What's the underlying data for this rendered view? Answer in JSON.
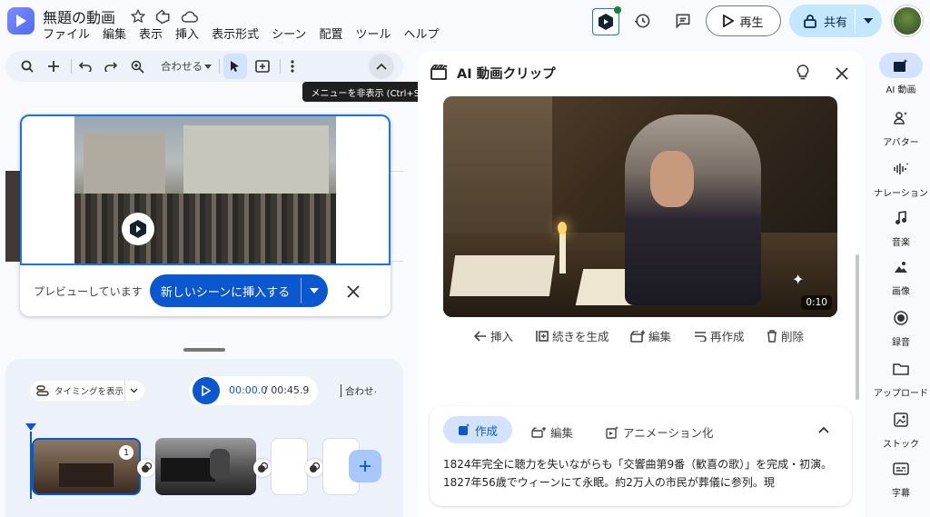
{
  "header": {
    "title": "無題の動画",
    "menus": [
      "ファイル",
      "編集",
      "表示",
      "挿入",
      "表示形式",
      "シーン",
      "配置",
      "ツール",
      "ヘルプ"
    ],
    "play_label": "再生",
    "share_label": "共有"
  },
  "toolbar": {
    "fit_label": "合わせる",
    "tooltip": "メニューを非表示 (Ctrl+Shift+F)"
  },
  "preview": {
    "status_text": "プレビューしています",
    "insert_label": "新しいシーンに挿入する"
  },
  "timeline": {
    "timing_label": "タイミングを表示",
    "current_time": "00:00.0",
    "total_time": "/ 00:45.9",
    "fit_label": "合わせる",
    "scene_badge": "1"
  },
  "panel": {
    "title": "AI 動画クリップ",
    "duration": "0:10",
    "actions": [
      "挿入",
      "続きを生成",
      "編集",
      "再作成",
      "削除"
    ],
    "tabs": [
      "作成",
      "編集",
      "アニメーション化"
    ],
    "description": "1824年完全に聴力を失いながらも「交響曲第9番（歓喜の歌）」を完成・初演。1827年56歳でウィーンにて永眠。約2万人の市民が葬儀に参列。現"
  },
  "rail": [
    "AI 動画",
    "アバター",
    "ナレーション",
    "音楽",
    "画像",
    "録音",
    "アップロード",
    "ストック",
    "字幕"
  ],
  "colors": {
    "accent": "#0b57d0",
    "share_bg": "#c2e7ff",
    "selected_bg": "#d3e3fd"
  }
}
